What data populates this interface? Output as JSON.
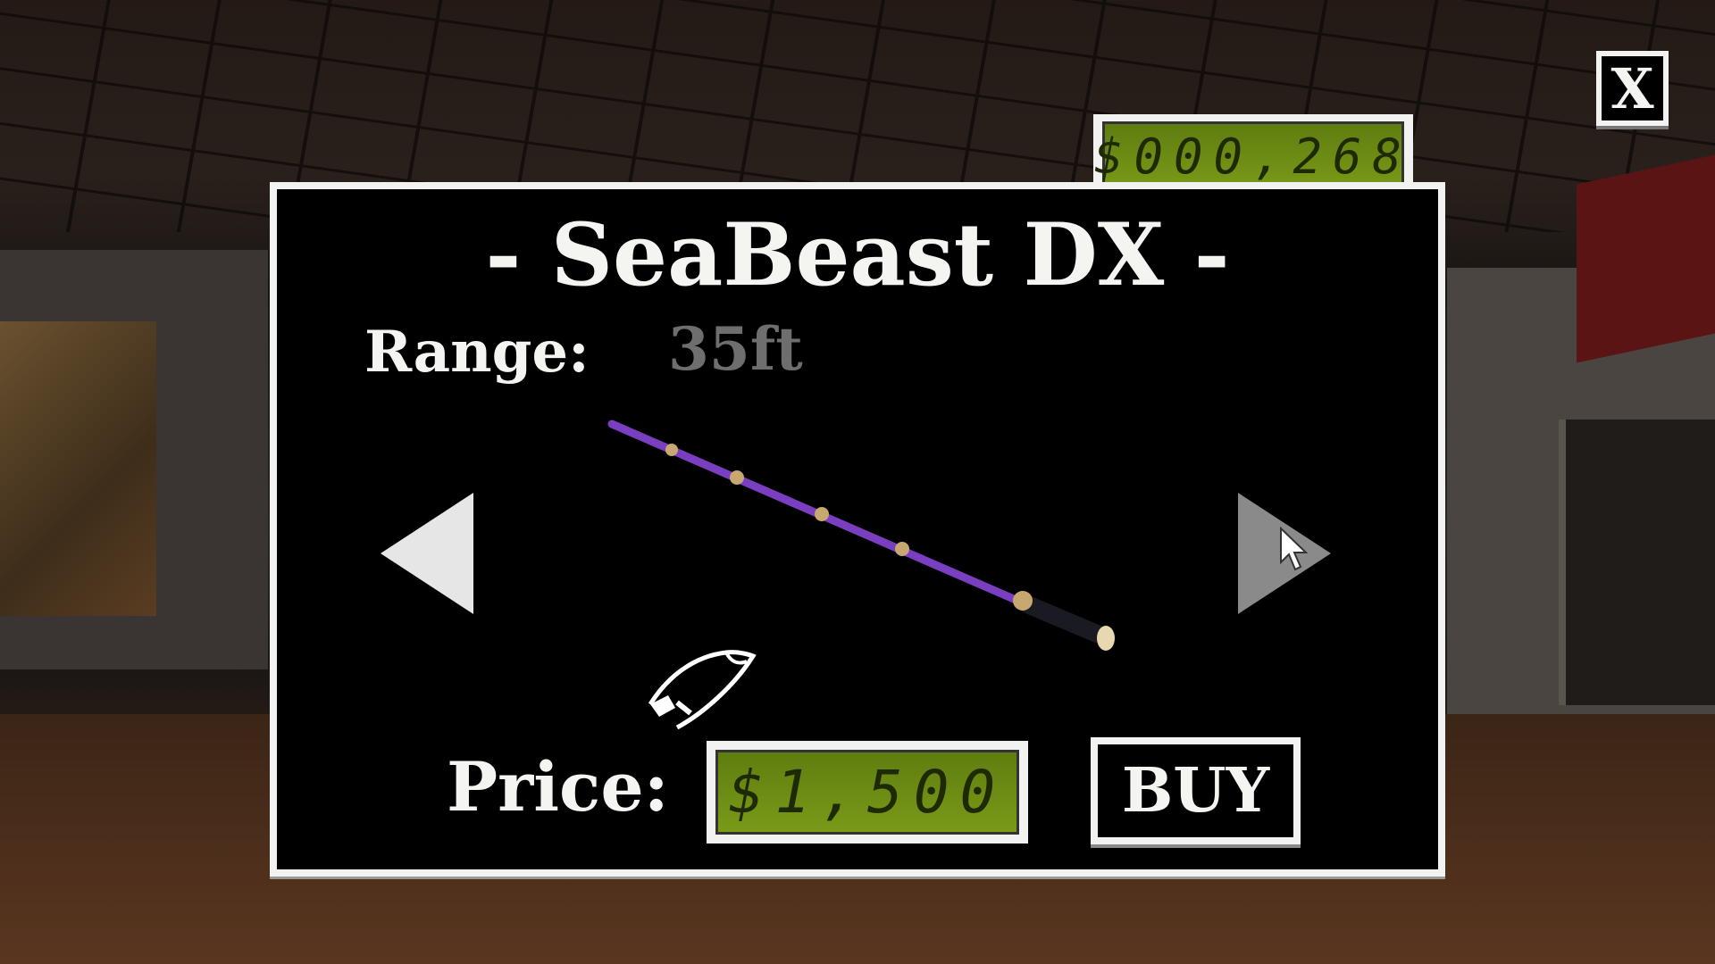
{
  "hud": {
    "money": "$000,268",
    "close_label": "X"
  },
  "shop": {
    "title": "- SeaBeast DX -",
    "range_label": "Range:",
    "range_value": "35ft",
    "price_label": "Price:",
    "price_value": "$1,500",
    "buy_label": "BUY",
    "rod_color": "#7a3fc0"
  },
  "colors": {
    "lcd_green": "#6e8c12",
    "panel": "#000000",
    "border": "#f2f2f0"
  }
}
